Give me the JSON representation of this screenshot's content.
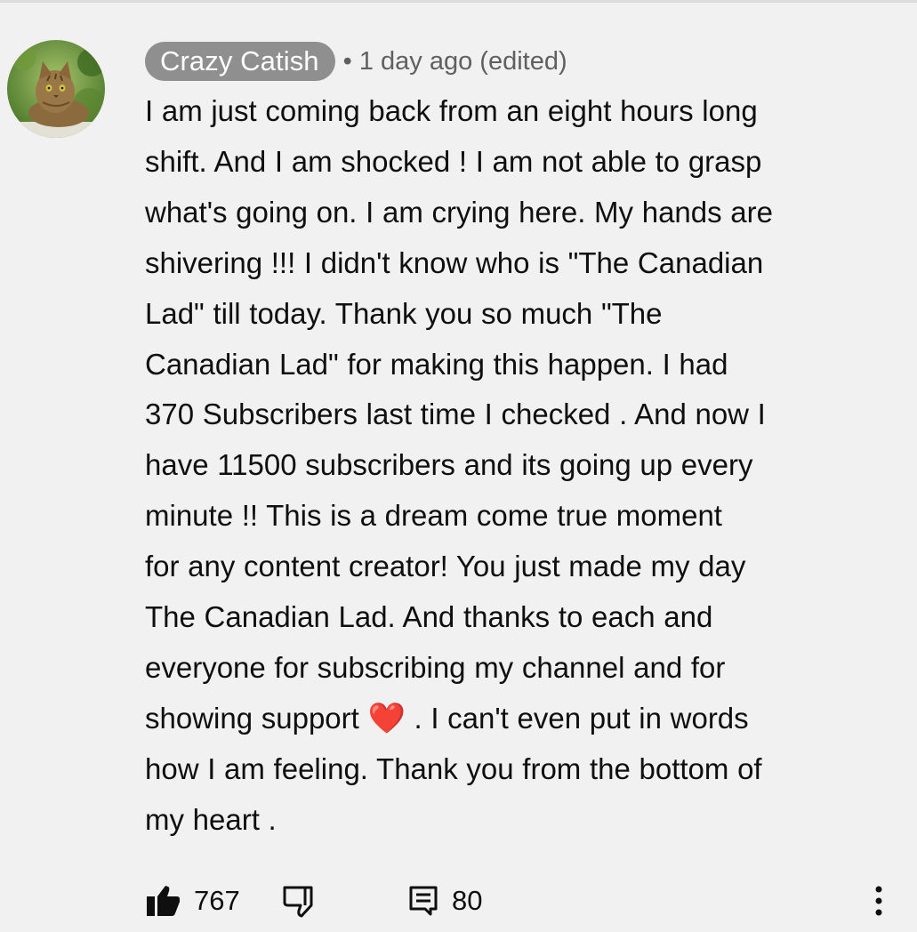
{
  "comment": {
    "author": "Crazy Catish",
    "meta": "• 1 day ago (edited)",
    "text_before_heart": "I am just coming back from an eight hours long\nshift. And I am shocked ! I am not able to grasp\nwhat's going on. I am crying here. My hands are\nshivering !!! I didn't know who is \"The Canadian\nLad\" till today. Thank you so much \"The\nCanadian Lad\" for making this happen. I had\n370 Subscribers last time I checked . And now I\nhave 11500 subscribers and its going up every\nminute !! This is a dream come true moment\nfor any content creator!  You just made my day\nThe Canadian Lad.  And thanks to each and\neveryone for subscribing my channel  and for\nshowing support ",
    "heart_emoji": "❤️",
    "text_after_heart": " .  I can't even put in words\nhow I am feeling. Thank you from the bottom of\nmy heart ."
  },
  "actions": {
    "like_count": "767",
    "reply_count": "80"
  },
  "icons": {
    "like": "thumbs-up-icon",
    "dislike": "thumbs-down-icon",
    "replies": "comment-icon",
    "menu": "more-vert-icon"
  },
  "colors": {
    "background": "#f1f1f1",
    "author_chip": "#8f8f8f",
    "meta_text": "#606060",
    "heart": "#e8323c"
  }
}
